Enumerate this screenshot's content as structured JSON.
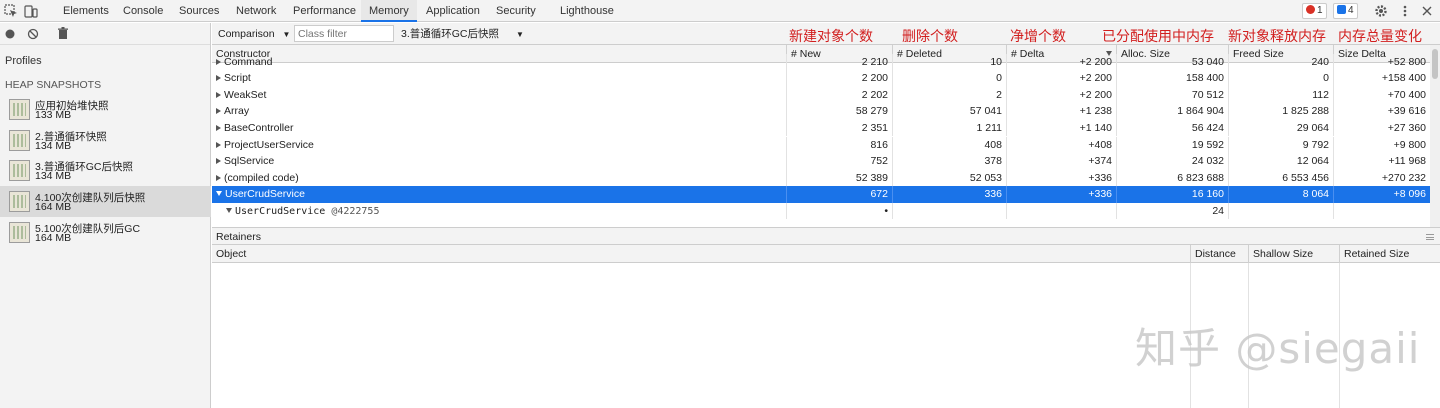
{
  "devtools_tabs": [
    "Elements",
    "Console",
    "Sources",
    "Network",
    "Performance",
    "Memory",
    "Application",
    "Security",
    "Lighthouse"
  ],
  "active_tab": "Memory",
  "errors_count": "1",
  "messages_count": "4",
  "colors": {
    "accent": "#1a73e8",
    "annotation": "#d21f1f",
    "error": "#d93025",
    "info": "#1a73e8"
  },
  "sidebar": {
    "profiles_label": "Profiles",
    "heap_label": "HEAP SNAPSHOTS",
    "snapshots": [
      {
        "name": "应用初始堆快照",
        "size": "133 MB"
      },
      {
        "name": "2.普通循环快照",
        "size": "134 MB"
      },
      {
        "name": "3.普通循环GC后快照",
        "size": "134 MB"
      },
      {
        "name": "4.100次创建队列后快照",
        "size": "164 MB"
      },
      {
        "name": "5.100次创建队列后GC",
        "size": "164 MB"
      }
    ],
    "selected_index": 3
  },
  "toolbar": {
    "view_mode": "Comparison",
    "class_filter_placeholder": "Class filter",
    "base_snapshot": "3.普通循环GC后快照"
  },
  "annotations": [
    "新建对象个数",
    "删除个数",
    "净增个数",
    "已分配使用中内存",
    "新对象释放内存",
    "内存总量变化"
  ],
  "table": {
    "columns": [
      "Constructor",
      "# New",
      "# Deleted",
      "# Delta",
      "Alloc. Size",
      "Freed Size",
      "Size Delta"
    ],
    "rows": [
      {
        "name": "Command",
        "new": "2 210",
        "deleted": "10",
        "delta": "+2 200",
        "alloc": "53 040",
        "freed": "240",
        "size_delta": "+52 800"
      },
      {
        "name": "Script",
        "new": "2 200",
        "deleted": "0",
        "delta": "+2 200",
        "alloc": "158 400",
        "freed": "0",
        "size_delta": "+158 400"
      },
      {
        "name": "WeakSet",
        "new": "2 202",
        "deleted": "2",
        "delta": "+2 200",
        "alloc": "70 512",
        "freed": "112",
        "size_delta": "+70 400"
      },
      {
        "name": "Array",
        "new": "58 279",
        "deleted": "57 041",
        "delta": "+1 238",
        "alloc": "1 864 904",
        "freed": "1 825 288",
        "size_delta": "+39 616"
      },
      {
        "name": "BaseController",
        "new": "2 351",
        "deleted": "1 211",
        "delta": "+1 140",
        "alloc": "56 424",
        "freed": "29 064",
        "size_delta": "+27 360"
      },
      {
        "name": "ProjectUserService",
        "new": "816",
        "deleted": "408",
        "delta": "+408",
        "alloc": "19 592",
        "freed": "9 792",
        "size_delta": "+9 800"
      },
      {
        "name": "SqlService",
        "new": "752",
        "deleted": "378",
        "delta": "+374",
        "alloc": "24 032",
        "freed": "12 064",
        "size_delta": "+11 968"
      },
      {
        "name": "(compiled code)",
        "new": "52 389",
        "deleted": "52 053",
        "delta": "+336",
        "alloc": "6 823 688",
        "freed": "6 553 456",
        "size_delta": "+270 232"
      },
      {
        "name": "UserCrudService",
        "new": "672",
        "deleted": "336",
        "delta": "+336",
        "alloc": "16 160",
        "freed": "8 064",
        "size_delta": "+8 096"
      }
    ],
    "child_row": {
      "name": "UserCrudService",
      "id": "@4222755",
      "new": "•",
      "alloc": "24"
    }
  },
  "retainers": {
    "title": "Retainers",
    "columns": [
      "Object",
      "Distance",
      "Shallow Size",
      "Retained Size"
    ]
  },
  "watermark": "知乎 @siegaii"
}
